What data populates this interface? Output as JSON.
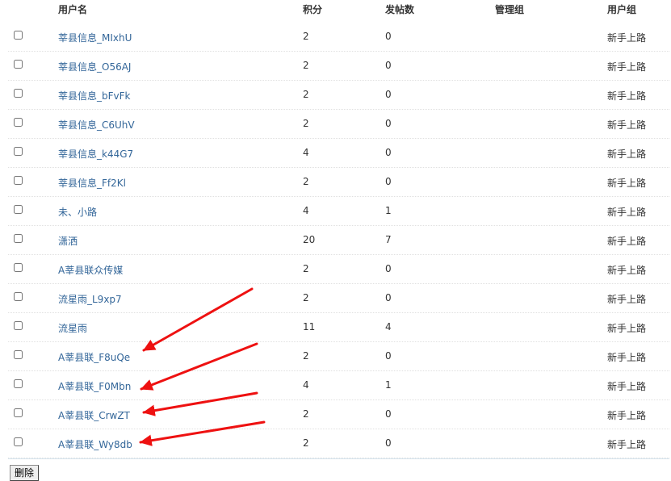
{
  "table": {
    "headers": {
      "username": "用户名",
      "score": "积分",
      "posts": "发帖数",
      "admin_group": "管理组",
      "user_group": "用户组"
    },
    "rows": [
      {
        "name": "莘县信息_MIxhU",
        "score": "2",
        "posts": "0",
        "admin_group": "",
        "user_group": "新手上路"
      },
      {
        "name": "莘县信息_O56AJ",
        "score": "2",
        "posts": "0",
        "admin_group": "",
        "user_group": "新手上路"
      },
      {
        "name": "莘县信息_bFvFk",
        "score": "2",
        "posts": "0",
        "admin_group": "",
        "user_group": "新手上路"
      },
      {
        "name": "莘县信息_C6UhV",
        "score": "2",
        "posts": "0",
        "admin_group": "",
        "user_group": "新手上路"
      },
      {
        "name": "莘县信息_k44G7",
        "score": "4",
        "posts": "0",
        "admin_group": "",
        "user_group": "新手上路"
      },
      {
        "name": "莘县信息_Ff2Kl",
        "score": "2",
        "posts": "0",
        "admin_group": "",
        "user_group": "新手上路"
      },
      {
        "name": "未、小路",
        "score": "4",
        "posts": "1",
        "admin_group": "",
        "user_group": "新手上路"
      },
      {
        "name": "潇洒",
        "score": "20",
        "posts": "7",
        "admin_group": "",
        "user_group": "新手上路"
      },
      {
        "name": "A莘县联众传媒",
        "score": "2",
        "posts": "0",
        "admin_group": "",
        "user_group": "新手上路"
      },
      {
        "name": "流星雨_L9xp7",
        "score": "2",
        "posts": "0",
        "admin_group": "",
        "user_group": "新手上路"
      },
      {
        "name": "流星雨",
        "score": "11",
        "posts": "4",
        "admin_group": "",
        "user_group": "新手上路"
      },
      {
        "name": "A莘县联_F8uQe",
        "score": "2",
        "posts": "0",
        "admin_group": "",
        "user_group": "新手上路"
      },
      {
        "name": "A莘县联_F0Mbn",
        "score": "4",
        "posts": "1",
        "admin_group": "",
        "user_group": "新手上路"
      },
      {
        "name": "A莘县联_CrwZT",
        "score": "2",
        "posts": "0",
        "admin_group": "",
        "user_group": "新手上路"
      },
      {
        "name": "A莘县联_Wy8db",
        "score": "2",
        "posts": "0",
        "admin_group": "",
        "user_group": "新手上路"
      }
    ]
  },
  "actions": {
    "delete_label": "删除"
  },
  "annotations": {
    "arrow_color": "#ee1111"
  },
  "colors": {
    "link": "#336699",
    "text": "#333333"
  }
}
